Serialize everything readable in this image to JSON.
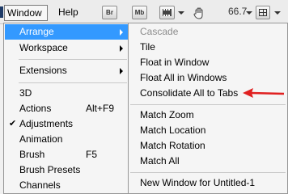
{
  "menubar": {
    "window_label": "Window",
    "help_label": "Help"
  },
  "toolbar": {
    "br_label": "Br",
    "mb_label": "Mb",
    "zoom_value": "66.7"
  },
  "window_menu": {
    "items": [
      {
        "label": "Arrange",
        "has_submenu": true,
        "selected": true
      },
      {
        "label": "Workspace",
        "has_submenu": true
      },
      {
        "label": "Extensions",
        "has_submenu": true
      },
      {
        "label": "3D"
      },
      {
        "label": "Actions",
        "shortcut": "Alt+F9"
      },
      {
        "label": "Adjustments",
        "checked": true
      },
      {
        "label": "Animation"
      },
      {
        "label": "Brush",
        "shortcut": "F5"
      },
      {
        "label": "Brush Presets"
      },
      {
        "label": "Channels"
      }
    ]
  },
  "arrange_submenu": {
    "items": [
      {
        "label": "Cascade",
        "disabled": true
      },
      {
        "label": "Tile"
      },
      {
        "label": "Float in Window"
      },
      {
        "label": "Float All in Windows"
      },
      {
        "label": "Consolidate All to Tabs"
      },
      {
        "label": "Match Zoom"
      },
      {
        "label": "Match Location"
      },
      {
        "label": "Match Rotation"
      },
      {
        "label": "Match All"
      },
      {
        "label": "New Window for Untitled-1"
      }
    ]
  },
  "icons": {
    "check": "✔",
    "annotation_arrow": "red-arrow-icon"
  },
  "colors": {
    "highlight": "#3399ff",
    "annotation": "#e02020",
    "disabled_text": "#8c8c8c"
  }
}
